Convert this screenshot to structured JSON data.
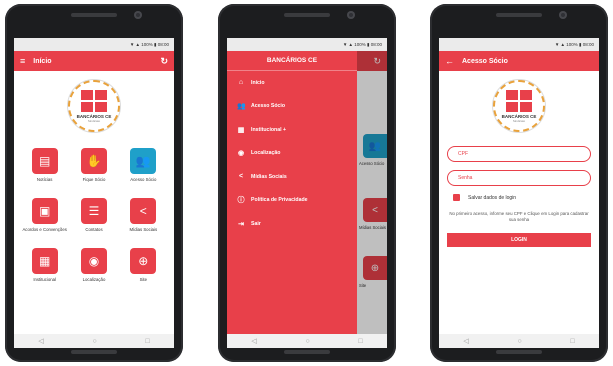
{
  "statusbar": {
    "text": "▼ ▲ 100% ▮ 08:00"
  },
  "phone1": {
    "title": "Início",
    "logo": {
      "name": "BANCÁRIOS CE",
      "sub": "Sindicato"
    },
    "tiles": [
      {
        "label": "Notícias",
        "icon": "news-icon",
        "glyph": "▤",
        "color": "#e8404a"
      },
      {
        "label": "Fique Sócio",
        "icon": "handshake-icon",
        "glyph": "✋",
        "color": "#e8404a"
      },
      {
        "label": "Acesso Sócio",
        "icon": "members-icon",
        "glyph": "👥",
        "color": "#1fa0c9"
      },
      {
        "label": "Acordos e Convenções",
        "icon": "document-icon",
        "glyph": "▣",
        "color": "#e8404a"
      },
      {
        "label": "Contatos",
        "icon": "chat-icon",
        "glyph": "☰",
        "color": "#e8404a"
      },
      {
        "label": "Mídias Sociais",
        "icon": "share-icon",
        "glyph": "<",
        "color": "#e8404a"
      },
      {
        "label": "Institucional",
        "icon": "building-icon",
        "glyph": "▦",
        "color": "#e8404a"
      },
      {
        "label": "Localização",
        "icon": "location-icon",
        "glyph": "◉",
        "color": "#e8404a"
      },
      {
        "label": "Site",
        "icon": "globe-icon",
        "glyph": "⊕",
        "color": "#e8404a"
      }
    ]
  },
  "phone2": {
    "drawer_title": "BANCÁRIOS CE",
    "items": [
      {
        "label": "Início",
        "icon": "home-icon",
        "glyph": "⌂"
      },
      {
        "label": "Acesso Sócio",
        "icon": "members-icon",
        "glyph": "👥"
      },
      {
        "label": "Institucional +",
        "icon": "building-icon",
        "glyph": "▦"
      },
      {
        "label": "Localização",
        "icon": "location-icon",
        "glyph": "◉"
      },
      {
        "label": "Mídias Sociais",
        "icon": "share-icon",
        "glyph": "<"
      },
      {
        "label": "Política de Privacidade",
        "icon": "info-icon",
        "glyph": "ⓘ"
      },
      {
        "label": "Sair",
        "icon": "exit-icon",
        "glyph": "⇥"
      }
    ],
    "peek_labels": [
      "Acesso Sócio",
      "Mídias Sociais",
      "Site"
    ]
  },
  "phone3": {
    "title": "Acesso Sócio",
    "logo": {
      "name": "BANCÁRIOS CE",
      "sub": "Sindicato"
    },
    "cpf_placeholder": "CPF",
    "senha_placeholder": "Senha",
    "save_label": "Salvar dados de login",
    "info": "No primeiro acesso, informe seu CPF e Clique em Login para cadastrar sua senha",
    "login_button": "LOGIN"
  },
  "navbar": {
    "back": "◁",
    "home": "○",
    "recent": "□"
  },
  "colors": {
    "accent": "#e8404a",
    "blue": "#1fa0c9"
  }
}
